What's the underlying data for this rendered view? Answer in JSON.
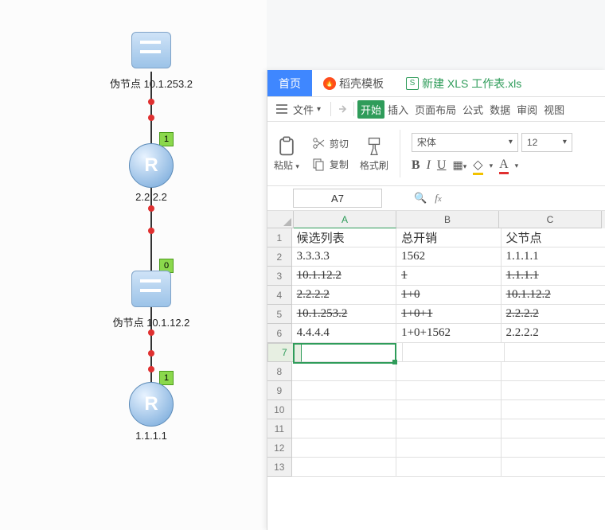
{
  "topo": {
    "n1": {
      "label": "伪节点 10.1.253.2"
    },
    "n2": {
      "label": "2.2.2.2"
    },
    "n3": {
      "label": "伪节点 10.1.12.2"
    },
    "n4": {
      "label": "1.1.1.1"
    },
    "badge_top": "1",
    "badge_mid": "0",
    "badge_bot": "1"
  },
  "tabs": {
    "home": "首页",
    "doke": "稻壳模板",
    "doc_prefix": "S",
    "doc": "新建 XLS 工作表.xls"
  },
  "menubar": {
    "file": "文件",
    "start": "开始",
    "insert": "插入",
    "layout": "页面布局",
    "formula": "公式",
    "data": "数据",
    "review": "审阅",
    "view": "视图"
  },
  "toolbar": {
    "paste": "粘贴",
    "cut": "剪切",
    "copy": "复制",
    "format_painter": "格式刷",
    "font_name": "宋体",
    "font_size": "12",
    "bold": "B",
    "italic": "I",
    "underline": "U",
    "A": "A"
  },
  "namebox": {
    "ref": "A7"
  },
  "columns": {
    "A": "A",
    "B": "B",
    "C": "C"
  },
  "sheet": {
    "rows": [
      {
        "num": "1",
        "a": "候选列表",
        "b": "总开销",
        "c": "父节点",
        "strike": false
      },
      {
        "num": "2",
        "a": "3.3.3.3",
        "b": "1562",
        "c": "1.1.1.1",
        "strike": false
      },
      {
        "num": "3",
        "a": "10.1.12.2",
        "b": "1",
        "c": "1.1.1.1",
        "strike": true
      },
      {
        "num": "4",
        "a": "2.2.2.2",
        "b": "1+0",
        "c": "10.1.12.2",
        "strike": true
      },
      {
        "num": "5",
        "a": "10.1.253.2",
        "b": "1+0+1",
        "c": "2.2.2.2",
        "strike": true
      },
      {
        "num": "6",
        "a": "4.4.4.4",
        "b": "1+0+1562",
        "c": "2.2.2.2",
        "strike": false
      },
      {
        "num": "7",
        "a": "",
        "b": "",
        "c": "",
        "strike": false
      },
      {
        "num": "8",
        "a": "",
        "b": "",
        "c": "",
        "strike": false
      },
      {
        "num": "9",
        "a": "",
        "b": "",
        "c": "",
        "strike": false
      },
      {
        "num": "10",
        "a": "",
        "b": "",
        "c": "",
        "strike": false
      },
      {
        "num": "11",
        "a": "",
        "b": "",
        "c": "",
        "strike": false
      },
      {
        "num": "12",
        "a": "",
        "b": "",
        "c": "",
        "strike": false
      },
      {
        "num": "13",
        "a": "",
        "b": "",
        "c": "",
        "strike": false
      }
    ]
  }
}
